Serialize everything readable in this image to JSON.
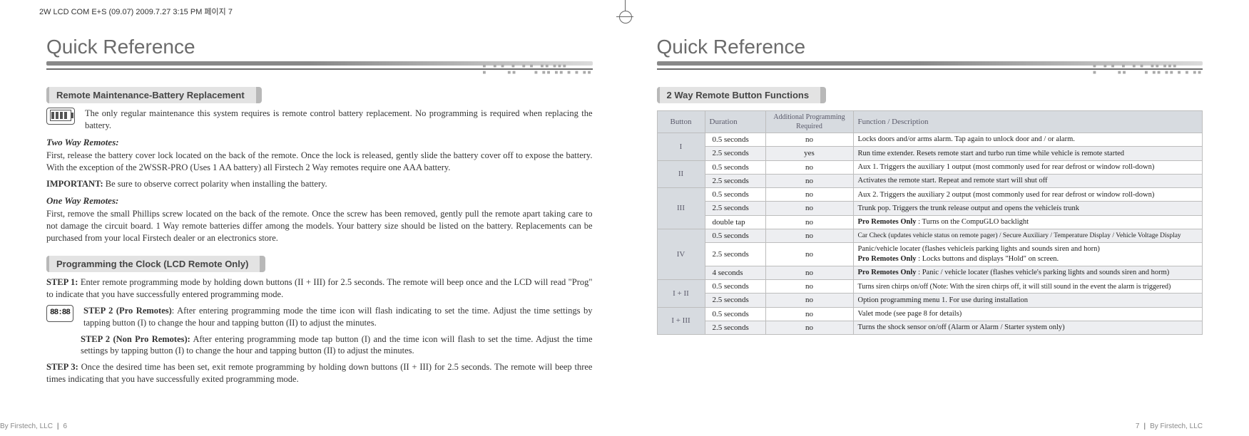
{
  "crop_header": "2W LCD COM E+S (09.07)  2009.7.27 3:15 PM  페이지 7",
  "left": {
    "title": "Quick Reference",
    "section1": "Remote Maintenance-Battery Replacement",
    "intro": "The only regular maintenance this system requires is remote control battery replacement. No programming is required when replacing the battery.",
    "two_way_head": "Two Way Remotes:",
    "two_way_p1": "First, release the battery cover lock located on the back of the remote. Once the lock is released, gently slide the battery cover off to expose the battery. With the exception of the 2WSSR-PRO (Uses 1 AA battery) all Firstech 2 Way remotes require one AAA battery.",
    "two_way_imp_label": "IMPORTANT:",
    "two_way_imp": "  Be sure to observe correct polarity when installing the battery.",
    "one_way_head": "One Way Remotes:",
    "one_way_p": "First, remove the small Phillips screw located on the back of the remote. Once the screw has been removed, gently pull the remote apart taking care to not damage the circuit board. 1 Way remote batteries differ among the models. Your battery size should be listed on the battery. Replacements can be purchased from your local Firstech dealer or an electronics store.",
    "section2": "Programming the Clock (LCD Remote Only)",
    "step1_label": "STEP 1:",
    "step1": " Enter remote programming mode by holding down buttons (II + III) for 2.5 seconds. The remote will beep once and the LCD will read \"Prog\" to indicate that you have successfully entered programming mode.",
    "lcd_icon": "88:88",
    "step2a_label": "STEP 2 (Pro Remotes)",
    "step2a": ": After entering programming mode the time icon will flash indicating to set the time. Adjust the time settings by tapping button (I) to change the hour and tapping button (II) to adjust the minutes.",
    "step2b_label": "STEP 2 (Non Pro Remotes):",
    "step2b": " After entering programming mode tap button (I) and the time icon will flash to set the time. Adjust the time settings by tapping button (I) to change the hour and tapping button (II) to adjust the minutes.",
    "step3_label": "STEP 3:",
    "step3": " Once the desired time has been set, exit remote programming by holding down buttons (II + III) for 2.5 seconds.  The remote will beep three times indicating that you have successfully exited programming mode.",
    "footer_company": "By Firstech, LLC",
    "footer_page": "6"
  },
  "right": {
    "title": "Quick Reference",
    "section1": "2 Way Remote Button Functions",
    "th_button": "Button",
    "th_duration": "Duration",
    "th_ap1": "Additional Programming",
    "th_ap2": "Required",
    "th_desc": "Function / Description",
    "rows": [
      {
        "btn": "I",
        "dur": "0.5 seconds",
        "ap": "no",
        "desc": "Locks doors and/or arms alarm. Tap again to unlock door and / or alarm."
      },
      {
        "btn": "",
        "dur": "2.5 seconds",
        "ap": "yes",
        "desc": "Run time extender. Resets remote start and turbo run time while vehicle is remote started"
      },
      {
        "btn": "II",
        "dur": "0.5 seconds",
        "ap": "no",
        "desc": "Aux 1. Triggers the auxiliary 1 output (most commonly used for rear defrost or window roll-down)"
      },
      {
        "btn": "",
        "dur": "2.5 seconds",
        "ap": "no",
        "desc": "Activates the remote start. Repeat and remote start will shut off"
      },
      {
        "btn": "III",
        "dur": "0.5 seconds",
        "ap": "no",
        "desc": "Aux 2. Triggers the auxiliary 2 output (most commonly used for rear defrost or window roll-down)"
      },
      {
        "btn": "",
        "dur": "2.5 seconds",
        "ap": "no",
        "desc": "Trunk pop. Triggers the trunk release output and opens the vehicleís trunk"
      },
      {
        "btn": "",
        "dur": "double tap",
        "ap": "no",
        "desc_b": "Pro Remotes Only",
        "desc": " : Turns on the CompuGLO backlight"
      },
      {
        "btn": "IV",
        "dur": "0.5 seconds",
        "ap": "no",
        "desc": "Car Check (updates vehicle status on remote pager) / Secure Auxiliary / Temperature Display / Vehicle Voltage Display"
      },
      {
        "btn": "",
        "dur": "2.5 seconds",
        "ap": "no",
        "desc": "Panic/vehicle locater (flashes vehicleís parking lights and sounds siren and horn)",
        "desc_b2": "Pro Remotes Only",
        "desc2": " : Locks buttons and displays \"Hold\" on screen."
      },
      {
        "btn": "",
        "dur": "4 seconds",
        "ap": "no",
        "desc_b": "Pro Remotes Only",
        "desc": " : Panic / vehicle locater (flashes vehicle's parking lights and sounds siren and horm)"
      },
      {
        "btn": "I + II",
        "dur": "0.5 seconds",
        "ap": "no",
        "desc": "Turns siren chirps on/off (Note: With the siren chirps off, it will still sound in the event the alarm is triggered)"
      },
      {
        "btn": "",
        "dur": "2.5 seconds",
        "ap": "no",
        "desc": "Option programming menu 1. For use during installation"
      },
      {
        "btn": "I + III",
        "dur": "0.5 seconds",
        "ap": "no",
        "desc": "Valet mode (see page 8 for details)"
      },
      {
        "btn": "",
        "dur": "2.5 seconds",
        "ap": "no",
        "desc": "Turns the shock sensor on/off (Alarm or Alarm / Starter system only)"
      }
    ],
    "footer_page": "7",
    "footer_company": "By Firstech, LLC"
  }
}
